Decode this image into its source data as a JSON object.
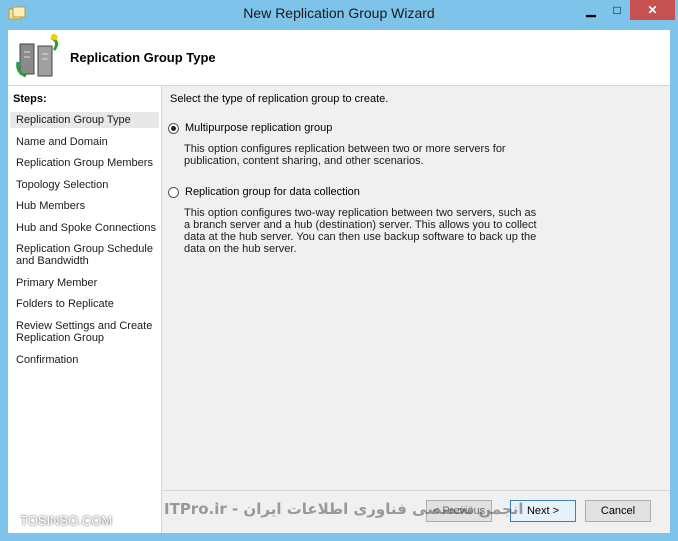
{
  "window": {
    "title": "New Replication Group Wizard"
  },
  "header": {
    "title": "Replication Group Type"
  },
  "steps": {
    "label": "Steps:",
    "items": [
      "Replication Group Type",
      "Name and Domain",
      "Replication Group Members",
      "Topology Selection",
      "Hub Members",
      "Hub and Spoke Connections",
      "Replication Group Schedule and Bandwidth",
      "Primary Member",
      "Folders to Replicate",
      "Review Settings and Create Replication Group",
      "Confirmation"
    ],
    "active_index": 0
  },
  "content": {
    "instruction": "Select the type of replication group to create.",
    "options": [
      {
        "label": "Multipurpose replication group",
        "selected": true,
        "description": "This option configures replication between two or more servers for publication, content sharing, and other scenarios."
      },
      {
        "label": "Replication group for data collection",
        "selected": false,
        "description": "This option configures two-way replication between two servers, such as a branch server and a hub (destination) server. This allows you to collect data at the hub server. You can then use backup software to back up the data on the hub server."
      }
    ]
  },
  "buttons": {
    "previous": "< Previous",
    "next": "Next >",
    "cancel": "Cancel"
  },
  "watermark": {
    "text": "ITPro.ir - انجمن تخصصی فناوری اطلاعات ایران",
    "site": "TOSINSO.COM"
  }
}
